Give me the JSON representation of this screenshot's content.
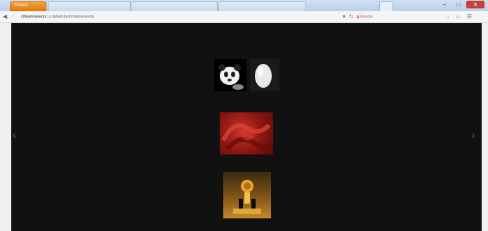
{
  "browser": {
    "app_button_label": "Firefox",
    "url": {
      "host": "clfiyamvaneq",
      "rest": "oc.z.mjmotutvohmotonovooto"
    },
    "search_engine_label": "Google",
    "window_controls": {
      "minimize": "–",
      "maximize": "□",
      "close": "✕"
    }
  },
  "viewer": {
    "prev_arrow": "‹",
    "next_arrow": "›",
    "thumbnails": [
      {
        "id": "panda",
        "icon": "panda-figure"
      },
      {
        "id": "egg",
        "icon": "white-egg"
      },
      {
        "id": "red-texture",
        "icon": "red-abstract"
      },
      {
        "id": "gold-statue",
        "icon": "gold-statue"
      }
    ]
  },
  "colors": {
    "page_background": "#111112",
    "chrome_tab": "#c9daee",
    "app_button": "#e0760c",
    "close_button": "#c7413a"
  }
}
